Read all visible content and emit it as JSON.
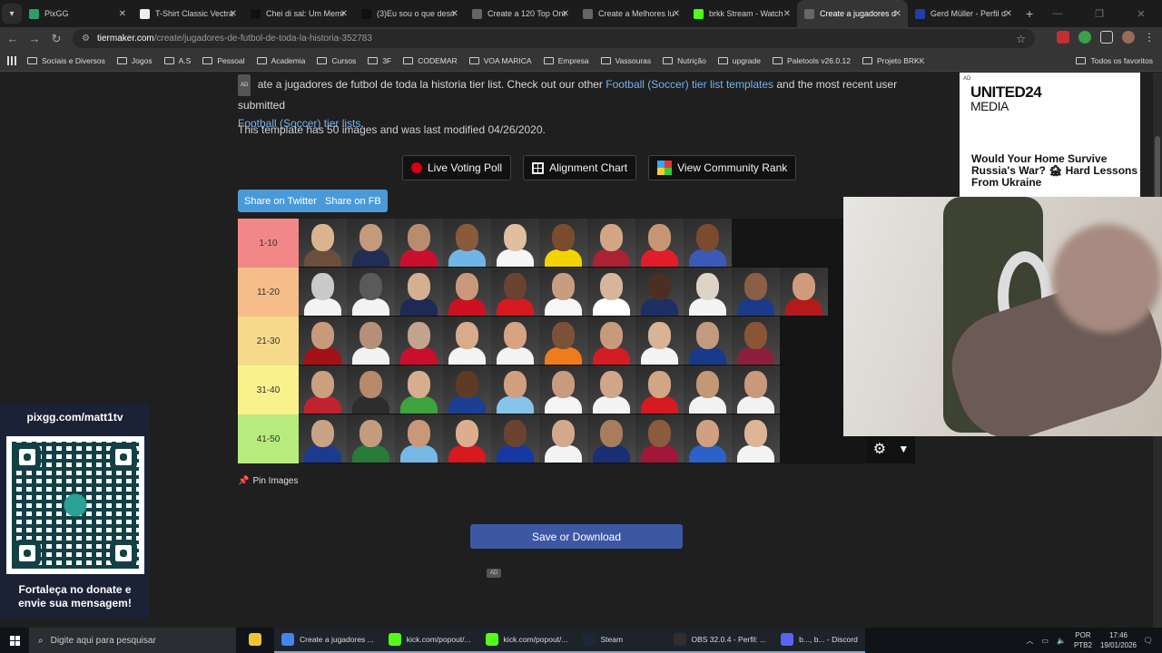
{
  "browser": {
    "tabs": [
      {
        "title": "PixGG",
        "color": "#2c9e6a",
        "active": false
      },
      {
        "title": "T-Shirt Classic Vectra",
        "color": "#eeeeee",
        "active": false
      },
      {
        "title": "Chei di sal: Um Meme",
        "color": "#111111",
        "active": false
      },
      {
        "title": "(3)Eu sou o que desm",
        "color": "#111111",
        "active": false
      },
      {
        "title": "Create a 120 Top One",
        "color": "#666666",
        "active": false
      },
      {
        "title": "Create a Melhores lu",
        "color": "#666666",
        "active": false
      },
      {
        "title": "brkk Stream - Watch",
        "color": "#53fc18",
        "active": false
      },
      {
        "title": "Create a jugadores d",
        "color": "#666666",
        "active": true
      },
      {
        "title": "Gerd Müller - Perfil d",
        "color": "#1e3fa8",
        "active": false
      }
    ],
    "url_host": "tiermaker.com",
    "url_path": "/create/jugadores-de-futbol-de-toda-la-historia-352783",
    "bookmarks": [
      "Sociais e Diversos",
      "Jogos",
      "A.S",
      "Pessoal",
      "Academia",
      "Cursos",
      "3F",
      "CODEMAR",
      "VOA MARICA",
      "Empresa",
      "Vassouras",
      "Nutrição",
      "upgrade",
      "Paletools v26.0.12",
      "Projeto BRKK"
    ],
    "bookmarks_right": "Todos os favoritos"
  },
  "page": {
    "ad_tag": "AD",
    "intro_text": "ate a jugadores de futbol de toda la historia tier list. Check out our other",
    "link_templates": "Football (Soccer) tier list templates",
    "intro_mid": "and the most recent user submitted",
    "link_lists": "Football (Soccer) tier lists",
    "intro_end": ".",
    "meta": "This template has 50 images and was last modified 04/26/2020.",
    "btn_poll": "Live Voting Poll",
    "btn_alignment": "Alignment Chart",
    "btn_rank": "View Community Rank",
    "share_twitter": "Share on Twitter",
    "share_fb": "Share on FB",
    "pin": "Pin Images",
    "save": "Save or Download",
    "ad_small": "AD"
  },
  "tiers": [
    {
      "label": "1-10",
      "color": "#f18787",
      "tiles": [
        [
          "#d9b48f",
          "#6b4e3b"
        ],
        [
          "#c49a7c",
          "#222d55"
        ],
        [
          "#b98c6e",
          "#c8102e"
        ],
        [
          "#8a5a3c",
          "#6fb6e6"
        ],
        [
          "#dfbfa0",
          "#f5f5f5"
        ],
        [
          "#7a4c2e",
          "#f1d400"
        ],
        [
          "#d4a585",
          "#aa2233"
        ],
        [
          "#c89574",
          "#e21d2b"
        ],
        [
          "#7a4b2c",
          "#3c59b8"
        ]
      ]
    },
    {
      "label": "11-20",
      "color": "#f6bd8a",
      "tiles": [
        [
          "#c9c9c9",
          "#f3f3f3"
        ],
        [
          "#5a5a5a",
          "#f3f3f3"
        ],
        [
          "#d4b091",
          "#1c2a55"
        ],
        [
          "#c9987a",
          "#cc1122"
        ],
        [
          "#6a4330",
          "#d71920"
        ],
        [
          "#c89c7f",
          "#f7f7f7"
        ],
        [
          "#d6b59c",
          "#ffffff"
        ],
        [
          "#4a2f22",
          "#1e2f66"
        ],
        [
          "#ddd3c6",
          "#f4f4f4"
        ],
        [
          "#8c5e43",
          "#1b3a8a"
        ],
        [
          "#cf9b7c",
          "#b31b1b"
        ]
      ]
    },
    {
      "label": "21-30",
      "color": "#f7d98c",
      "tiles": [
        [
          "#c99a7a",
          "#a41218"
        ],
        [
          "#b58f78",
          "#f2f2f2"
        ],
        [
          "#c3a28e",
          "#c8102e"
        ],
        [
          "#d9ab8a",
          "#f4f4f4"
        ],
        [
          "#d7a380",
          "#f3f3f3"
        ],
        [
          "#7d5138",
          "#f07b1d"
        ],
        [
          "#c89a7c",
          "#d31c24"
        ],
        [
          "#d8b396",
          "#f4f4f4"
        ],
        [
          "#c39a7d",
          "#173a8a"
        ],
        [
          "#8a5535",
          "#8c1f3c"
        ]
      ]
    },
    {
      "label": "31-40",
      "color": "#f9f28c",
      "tiles": [
        [
          "#caa07f",
          "#c0232e"
        ],
        [
          "#b78a6b",
          "#2d2d2d"
        ],
        [
          "#d5ae90",
          "#3da33d"
        ],
        [
          "#5e3b25",
          "#1c3f94"
        ],
        [
          "#d0a07e",
          "#86c4ec"
        ],
        [
          "#c99b7e",
          "#f5f5f5"
        ],
        [
          "#d1a58a",
          "#f4f4f4"
        ],
        [
          "#d2a585",
          "#d71920"
        ],
        [
          "#c49775",
          "#f2f2f2"
        ],
        [
          "#c89a7b",
          "#f2f2f2"
        ]
      ]
    },
    {
      "label": "41-50",
      "color": "#b6ec7d",
      "tiles": [
        [
          "#caa284",
          "#1c3a8f"
        ],
        [
          "#c59b7e",
          "#2a7a3a"
        ],
        [
          "#c99779",
          "#76b9e6"
        ],
        [
          "#dcae8e",
          "#d71920"
        ],
        [
          "#6a4330",
          "#1538a3"
        ],
        [
          "#d2a98c",
          "#f4f4f4"
        ],
        [
          "#a97c5c",
          "#1a2f75"
        ],
        [
          "#8c5a3d",
          "#a2163a"
        ],
        [
          "#d0a080",
          "#2c62c8"
        ],
        [
          "#dcb597",
          "#f4f4f4"
        ]
      ]
    }
  ],
  "ad_right": {
    "tag": "AD",
    "brand": "UNITED24",
    "brand2": "MEDIA",
    "headline": "Would Your Home Survive Russia's War? 🏚 Hard Lessons From Ukraine"
  },
  "overlay": {
    "handle": "pixgg.com/matt1tv",
    "message_line1": "Fortaleça no donate e",
    "message_line2": "envie sua mensagem!"
  },
  "taskbar": {
    "search_placeholder": "Digite aqui para pesquisar",
    "items": [
      {
        "label": "",
        "color": "#f4c430"
      },
      {
        "label": "Create a jugadores ...",
        "color": "#4285f4"
      },
      {
        "label": "kick.com/popout/...",
        "color": "#53fc18"
      },
      {
        "label": "kick.com/popout/...",
        "color": "#53fc18"
      },
      {
        "label": "Steam",
        "color": "#1b2838"
      },
      {
        "label": "OBS 32.0.4 - Perfil: ...",
        "color": "#302e31"
      },
      {
        "label": "b..., b... - Discord",
        "color": "#5865f2"
      }
    ],
    "lang": "POR",
    "layout": "PTB2",
    "time": "17:46",
    "date": "19/01/2026"
  }
}
